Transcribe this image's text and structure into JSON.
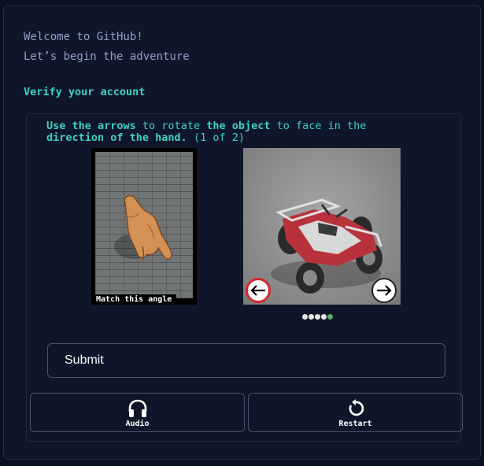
{
  "welcome": {
    "line1": "Welcome to GitHub!",
    "line2": "Let’s begin the adventure"
  },
  "verify_heading": "Verify your account",
  "challenge": {
    "instruction_bold_1": "Use the arrows",
    "instruction_normal_1": " to rotate ",
    "instruction_bold_2": "the object",
    "instruction_normal_2": " to face in the ",
    "instruction_bold_3": "direction of the hand.",
    "instruction_normal_3": " (1 of 2)",
    "reference_label": "Match this angle",
    "reference_image_icon": "hand-pointing-icon",
    "object_image_icon": "atv-quad-bike-icon",
    "left_arrow_icon": "arrow-left-icon",
    "right_arrow_icon": "arrow-right-icon",
    "progress_dots": [
      {
        "color": "#e8e8e8"
      },
      {
        "color": "#e8e8e8"
      },
      {
        "color": "#e8e8e8"
      },
      {
        "color": "#e8e8e8"
      },
      {
        "color": "#5fa86a"
      }
    ]
  },
  "submit_label": "Submit",
  "audio": {
    "label": "Audio",
    "icon": "headphones-icon"
  },
  "restart": {
    "label": "Restart",
    "icon": "restart-icon"
  },
  "colors": {
    "accent": "#40d1c5",
    "background": "#0f1629",
    "text_muted": "#8ea2c8"
  }
}
